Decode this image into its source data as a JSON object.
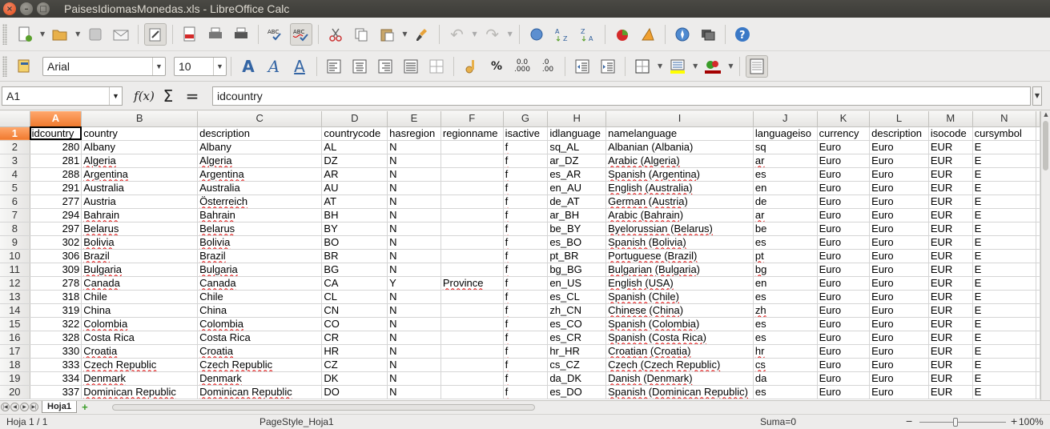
{
  "window": {
    "title": "PaisesIdiomasMonedas.xls - LibreOffice Calc"
  },
  "toolbar2": {
    "font_name": "Arial",
    "font_size": "10"
  },
  "formula_bar": {
    "cell_ref": "A1",
    "content": "idcountry",
    "fx": "f(x)",
    "sigma": "Σ",
    "equals": "="
  },
  "grid": {
    "columns": [
      "A",
      "B",
      "C",
      "D",
      "E",
      "F",
      "G",
      "H",
      "I",
      "J",
      "K",
      "L",
      "M",
      "N"
    ],
    "row_numbers": [
      "1",
      "2",
      "3",
      "4",
      "5",
      "6",
      "7",
      "8",
      "9",
      "10",
      "11",
      "12",
      "13",
      "14",
      "15",
      "16",
      "17",
      "18",
      "19",
      "20"
    ],
    "header_row": [
      "idcountry",
      "country",
      "description",
      "countrycode",
      "hasregion",
      "regionname",
      "isactive",
      "idlanguage",
      "namelanguage",
      "languageiso",
      "currency",
      "description",
      "isocode",
      "cursymbol"
    ],
    "rows": [
      [
        "280",
        "Albany",
        "Albany",
        "AL",
        "N",
        "",
        "f",
        "sq_AL",
        "Albanian (Albania)",
        "sq",
        "Euro",
        "Euro",
        "EUR",
        "E"
      ],
      [
        "281",
        "Algeria",
        "Algeria",
        "DZ",
        "N",
        "",
        "f",
        "ar_DZ",
        "Arabic (Algeria)",
        "ar",
        "Euro",
        "Euro",
        "EUR",
        "E"
      ],
      [
        "288",
        "Argentina",
        "Argentina",
        "AR",
        "N",
        "",
        "f",
        "es_AR",
        "Spanish (Argentina)",
        "es",
        "Euro",
        "Euro",
        "EUR",
        "E"
      ],
      [
        "291",
        "Australia",
        "Australia",
        "AU",
        "N",
        "",
        "f",
        "en_AU",
        "English (Australia)",
        "en",
        "Euro",
        "Euro",
        "EUR",
        "E"
      ],
      [
        "277",
        "Austria",
        "Österreich",
        "AT",
        "N",
        "",
        "f",
        "de_AT",
        "German (Austria)",
        "de",
        "Euro",
        "Euro",
        "EUR",
        "E"
      ],
      [
        "294",
        "Bahrain",
        "Bahrain",
        "BH",
        "N",
        "",
        "f",
        "ar_BH",
        "Arabic (Bahrain)",
        "ar",
        "Euro",
        "Euro",
        "EUR",
        "E"
      ],
      [
        "297",
        "Belarus",
        "Belarus",
        "BY",
        "N",
        "",
        "f",
        "be_BY",
        "Byelorussian (Belarus)",
        "be",
        "Euro",
        "Euro",
        "EUR",
        "E"
      ],
      [
        "302",
        "Bolivia",
        "Bolivia",
        "BO",
        "N",
        "",
        "f",
        "es_BO",
        "Spanish (Bolivia)",
        "es",
        "Euro",
        "Euro",
        "EUR",
        "E"
      ],
      [
        "306",
        "Brazil",
        "Brazil",
        "BR",
        "N",
        "",
        "f",
        "pt_BR",
        "Portuguese (Brazil)",
        "pt",
        "Euro",
        "Euro",
        "EUR",
        "E"
      ],
      [
        "309",
        "Bulgaria",
        "Bulgaria",
        "BG",
        "N",
        "",
        "f",
        "bg_BG",
        "Bulgarian (Bulgaria)",
        "bg",
        "Euro",
        "Euro",
        "EUR",
        "E"
      ],
      [
        "278",
        "Canada",
        "Canada",
        "CA",
        "Y",
        "Province",
        "f",
        "en_US",
        "English (USA)",
        "en",
        "Euro",
        "Euro",
        "EUR",
        "E"
      ],
      [
        "318",
        "Chile",
        "Chile",
        "CL",
        "N",
        "",
        "f",
        "es_CL",
        "Spanish (Chile)",
        "es",
        "Euro",
        "Euro",
        "EUR",
        "E"
      ],
      [
        "319",
        "China",
        "China",
        "CN",
        "N",
        "",
        "f",
        "zh_CN",
        "Chinese (China)",
        "zh",
        "Euro",
        "Euro",
        "EUR",
        "E"
      ],
      [
        "322",
        "Colombia",
        "Colombia",
        "CO",
        "N",
        "",
        "f",
        "es_CO",
        "Spanish (Colombia)",
        "es",
        "Euro",
        "Euro",
        "EUR",
        "E"
      ],
      [
        "328",
        "Costa Rica",
        "Costa Rica",
        "CR",
        "N",
        "",
        "f",
        "es_CR",
        "Spanish (Costa Rica)",
        "es",
        "Euro",
        "Euro",
        "EUR",
        "E"
      ],
      [
        "330",
        "Croatia",
        "Croatia",
        "HR",
        "N",
        "",
        "f",
        "hr_HR",
        "Croatian (Croatia)",
        "hr",
        "Euro",
        "Euro",
        "EUR",
        "E"
      ],
      [
        "333",
        "Czech Republic",
        "Czech Republic",
        "CZ",
        "N",
        "",
        "f",
        "cs_CZ",
        "Czech (Czech Republic)",
        "cs",
        "Euro",
        "Euro",
        "EUR",
        "E"
      ],
      [
        "334",
        "Denmark",
        "Denmark",
        "DK",
        "N",
        "",
        "f",
        "da_DK",
        "Danish (Denmark)",
        "da",
        "Euro",
        "Euro",
        "EUR",
        "E"
      ],
      [
        "337",
        "Dominican Republic",
        "Dominican Republic",
        "DO",
        "N",
        "",
        "f",
        "es_DO",
        "Spanish (Dominican Republic)",
        "es",
        "Euro",
        "Euro",
        "EUR",
        "E"
      ]
    ]
  },
  "sheet_tabs": {
    "active": "Hoja1",
    "add": "+"
  },
  "status_bar": {
    "sheet_info": "Hoja 1 / 1",
    "page_style": "PageStyle_Hoja1",
    "sum": "Suma=0",
    "zoom_minus": "−",
    "zoom_plus": "+",
    "zoom": "100%"
  },
  "colors": {
    "selection": "#f07a2e",
    "spell_error": "#e00000",
    "titlebar": "#3c3b37"
  }
}
